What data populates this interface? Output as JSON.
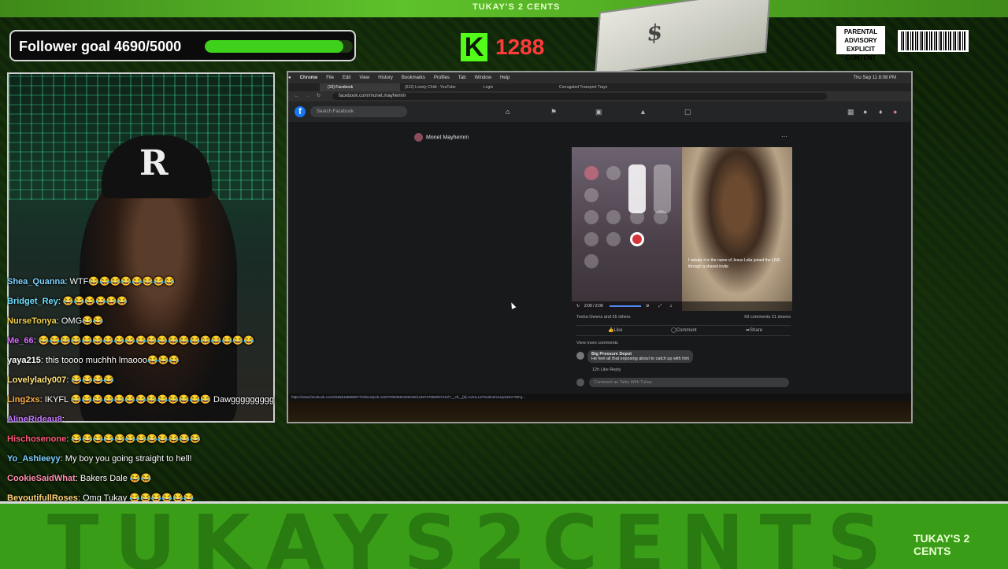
{
  "overlay": {
    "top_title": "TUKAY'S 2 CENTS",
    "follower_goal_label": "Follower goal 4690/5000",
    "follower_goal_progress": 0.938,
    "kick_letter": "K",
    "kick_count": "1288",
    "advisory_text": "PARENTAL ADVISORY EXPLICIT CONTENT",
    "banner_text": "TUKAYS2CENTS",
    "banner_logo": "TUKAY'S 2 CENTS",
    "colors": {
      "goal_fill": "#3ed11c",
      "kick_green": "#53fc18",
      "kick_count": "#ff3b3b",
      "banner": "#3a9d18"
    }
  },
  "chat": [
    {
      "user": "Shea_Quanna",
      "color": "#7fd0ff",
      "text": ": WTF😂😂😂😂😂😂😂😂"
    },
    {
      "user": "Bridget_Rey",
      "color": "#6fe0ff",
      "text": ": 😂😂😂😂😂😂"
    },
    {
      "user": "NurseTonya",
      "color": "#f2d14a",
      "text": ": OMG😂😂"
    },
    {
      "user": "Me_66",
      "color": "#d66bff",
      "text": ": 😂😂😂😂😂😂😂😂😂😂😂😂😂😂😂😂😂😂😂😂"
    },
    {
      "user": "yaya215",
      "color": "#ffffff",
      "text": ": this toooo muchhh lmaooo😂😂😂"
    },
    {
      "user": "Lovelylady007",
      "color": "#ffe27a",
      "text": ": 😂😂😂😂"
    },
    {
      "user": "Ling2xs",
      "color": "#ffb347",
      "text": ": IKYFL 😂😂😂😂😂😂😂😂😂😂😂😂😂 Dawggggggggg"
    },
    {
      "user": "AlineRideau8",
      "color": "#c47dff",
      "text": ":"
    },
    {
      "user": "Hischosenone",
      "color": "#ff5a7a",
      "text": ": 😂😂😂😂😂😂😂😂😂😂😂😂"
    },
    {
      "user": "Yo_Ashleeyy",
      "color": "#7fd0ff",
      "text": ": My boy you going straight to hell!"
    },
    {
      "user": "CookieSaidWhat",
      "color": "#ff8fb1",
      "text": ": Bakers Dale 😂😂"
    },
    {
      "user": "BeyoutifullRoses",
      "color": "#ffd27a",
      "text": ": Omg Tukay 😂😂😂😂😂😂"
    }
  ],
  "browser": {
    "menu": [
      "Chrome",
      "File",
      "Edit",
      "View",
      "History",
      "Bookmarks",
      "Profiles",
      "Tab",
      "Window",
      "Help"
    ],
    "clock": "Thu Sep 11 8:08 PM",
    "tabs": [
      "(10) Facebook",
      "(612) Lonely Child - YouTube",
      "Login",
      "Corrugated Transport Trays"
    ],
    "url": "facebook.com/monet.mayhemm",
    "search_placeholder": "Search Facebook",
    "page_name": "Monet Mayhemm",
    "video_time": "2:09 / 2:09",
    "live_comments": "I rebuke it in the name of Jesus\nLolia joined the LIVE through a shared invite",
    "reactions": "Tesha Owens and 55 others",
    "counts": "69 comments  21 shares",
    "like": "Like",
    "comment": "Comment",
    "share": "Share",
    "view_more": "View more comments",
    "comment_author": "Big Pressure Depot",
    "comment_text": "He feel all that exposing about to catch up with him",
    "comment_meta": "12h  Like  Reply",
    "comment_placeholder": "Comment as Talks With Tukay",
    "status_url": "https://www.facebook.com/61556186856077/videos/pcb.122278393562206228/1448737556097212/?__cft__[0]=AZULLZ7NcdU2nvUqvsZ2V7WFg..."
  }
}
